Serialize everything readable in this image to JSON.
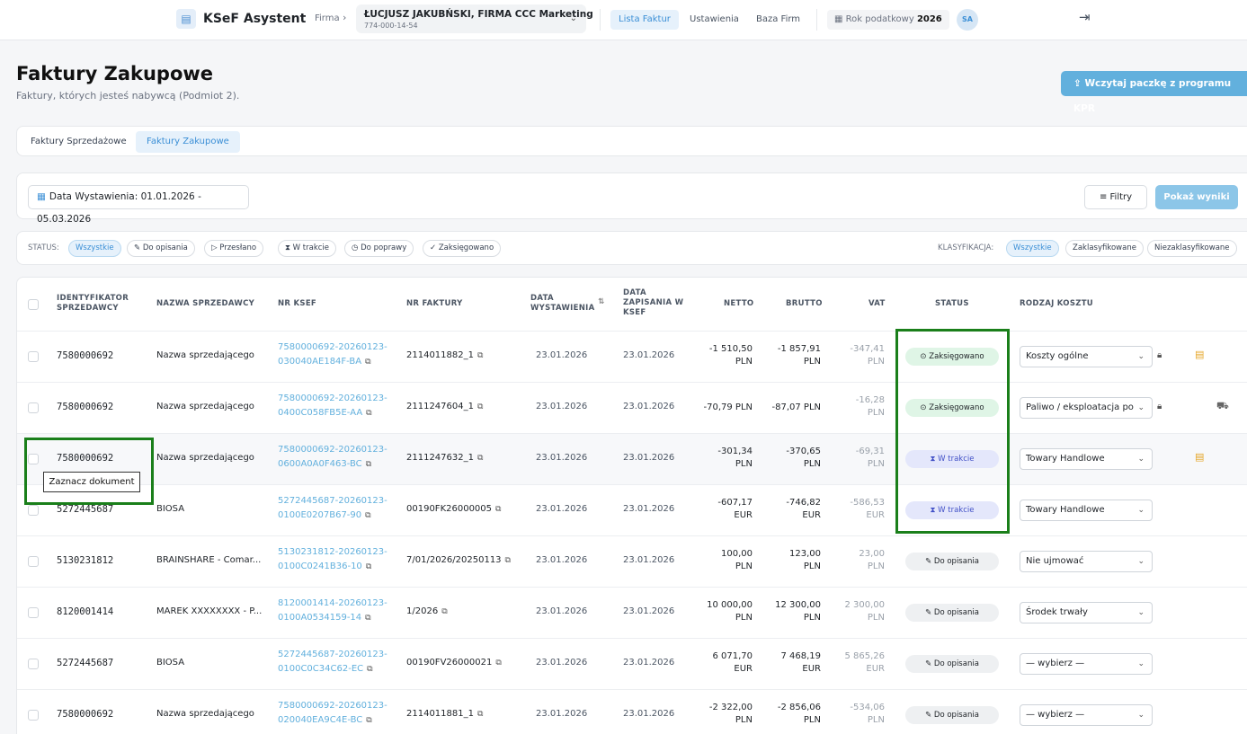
{
  "topbar": {
    "brand": "KSeF Asystent",
    "firma_label": "Firma",
    "firma_name": "ŁUCJUSZ JAKUBŃSKI, FIRMA CCC Marketing",
    "firma_nip": "774-000-14-54",
    "nav": [
      "Lista Faktur",
      "Ustawienia",
      "Baza Firm"
    ],
    "year_label": "Rok podatkowy",
    "year_value": "2026",
    "avatar": "SA"
  },
  "header": {
    "title": "Faktury Zakupowe",
    "subtitle": "Faktury, których jesteś nabywcą (Podmiot 2).",
    "kpr_button": "Wczytaj paczkę z programu KPR"
  },
  "tabs": [
    "Faktury Sprzedażowe",
    "Faktury Zakupowe"
  ],
  "filters": {
    "date": "Data Wystawienia: 01.01.2026 - 05.03.2026",
    "filtry": "Filtry",
    "pokaz": "Pokaż wyniki"
  },
  "status_filter": {
    "label": "STATUS:",
    "chips": [
      "Wszystkie",
      "Do opisania",
      "Przesłano",
      "W trakcie",
      "Do poprawy",
      "Zaksięgowano"
    ],
    "klas_label": "KLASYFIKACJA:",
    "klas_chips": [
      "Wszystkie",
      "Zaklasyfikowane",
      "Niezaklasyfikowane"
    ]
  },
  "table": {
    "headers": {
      "id": "IDENTYFIKATOR SPRZEDAWCY",
      "name": "NAZWA SPRZEDAWCY",
      "ksef": "NR KSEF",
      "faktura": "NR FAKTURY",
      "data_wyst": "DATA WYSTAWIENIA",
      "data_zap": "DATA ZAPISANIA W KSEF",
      "netto": "NETTO",
      "brutto": "BRUTTO",
      "vat": "VAT",
      "status": "STATUS",
      "koszt": "RODZAJ KOSZTU"
    },
    "rows": [
      {
        "id": "7580000692",
        "name": "Nazwa sprzedającego",
        "ksef1": "7580000692-20260123-",
        "ksef2": "030040AE184F-BA",
        "faktura": "2114011882_1",
        "wyst": "23.01.2026",
        "zap": "23.01.2026",
        "netto1": "-1 510,50",
        "netto2": "PLN",
        "brutto1": "-1 857,91",
        "brutto2": "PLN",
        "vat1": "-347,41",
        "vat2": "PLN",
        "status": "Zaksięgowano",
        "koszt": "Koszty ogólne"
      },
      {
        "id": "7580000692",
        "name": "Nazwa sprzedającego",
        "ksef1": "7580000692-20260123-",
        "ksef2": "0400C058FB5E-AA",
        "faktura": "2111247604_1",
        "wyst": "23.01.2026",
        "zap": "23.01.2026",
        "netto1": "-70,79 PLN",
        "netto2": "",
        "brutto1": "-87,07 PLN",
        "brutto2": "",
        "vat1": "-16,28",
        "vat2": "PLN",
        "status": "Zaksięgowano",
        "koszt": "Paliwo / eksploatacja po"
      },
      {
        "id": "7580000692",
        "name": "Nazwa sprzedającego",
        "ksef1": "7580000692-20260123-",
        "ksef2": "0600A0A0F463-BC",
        "faktura": "2111247632_1",
        "wyst": "23.01.2026",
        "zap": "23.01.2026",
        "netto1": "-301,34",
        "netto2": "PLN",
        "brutto1": "-370,65",
        "brutto2": "PLN",
        "vat1": "-69,31",
        "vat2": "PLN",
        "status": "W trakcie",
        "koszt": "Towary Handlowe"
      },
      {
        "id": "5272445687",
        "name": "BIOSA",
        "ksef1": "5272445687-20260123-",
        "ksef2": "0100E0207B67-90",
        "faktura": "00190FK26000005",
        "wyst": "23.01.2026",
        "zap": "23.01.2026",
        "netto1": "-607,17",
        "netto2": "EUR",
        "brutto1": "-746,82",
        "brutto2": "EUR",
        "vat1": "-586,53",
        "vat2": "EUR",
        "status": "W trakcie",
        "koszt": "Towary Handlowe"
      },
      {
        "id": "5130231812",
        "name": "BRAINSHARE - Comar...",
        "ksef1": "5130231812-20260123-",
        "ksef2": "0100C0241B36-10",
        "faktura": "7/01/2026/20250113",
        "wyst": "23.01.2026",
        "zap": "23.01.2026",
        "netto1": "100,00",
        "netto2": "PLN",
        "brutto1": "123,00",
        "brutto2": "PLN",
        "vat1": "23,00",
        "vat2": "PLN",
        "status": "Do opisania",
        "koszt": "Nie ujmować"
      },
      {
        "id": "8120001414",
        "name": "MAREK XXXXXXXX - P...",
        "ksef1": "8120001414-20260123-",
        "ksef2": "0100A0534159-14",
        "faktura": "1/2026",
        "wyst": "23.01.2026",
        "zap": "23.01.2026",
        "netto1": "10 000,00",
        "netto2": "PLN",
        "brutto1": "12 300,00",
        "brutto2": "PLN",
        "vat1": "2 300,00",
        "vat2": "PLN",
        "status": "Do opisania",
        "koszt": "Środek trwały"
      },
      {
        "id": "5272445687",
        "name": "BIOSA",
        "ksef1": "5272445687-20260123-",
        "ksef2": "0100C0C34C62-EC",
        "faktura": "00190FV26000021",
        "wyst": "23.01.2026",
        "zap": "23.01.2026",
        "netto1": "6 071,70",
        "netto2": "EUR",
        "brutto1": "7 468,19",
        "brutto2": "EUR",
        "vat1": "5 865,26",
        "vat2": "EUR",
        "status": "Do opisania",
        "koszt": "— wybierz —"
      },
      {
        "id": "7580000692",
        "name": "Nazwa sprzedającego",
        "ksef1": "7580000692-20260123-",
        "ksef2": "020040EA9C4E-BC",
        "faktura": "2114011881_1",
        "wyst": "23.01.2026",
        "zap": "23.01.2026",
        "netto1": "-2 322,00",
        "netto2": "PLN",
        "brutto1": "-2 856,06",
        "brutto2": "PLN",
        "vat1": "-534,06",
        "vat2": "PLN",
        "status": "Do opisania",
        "koszt": "— wybierz —"
      }
    ]
  },
  "tooltip": "Zaznacz dokument",
  "colors": {
    "accent": "#3b8fd6",
    "highlight": "#1a7f1a"
  }
}
